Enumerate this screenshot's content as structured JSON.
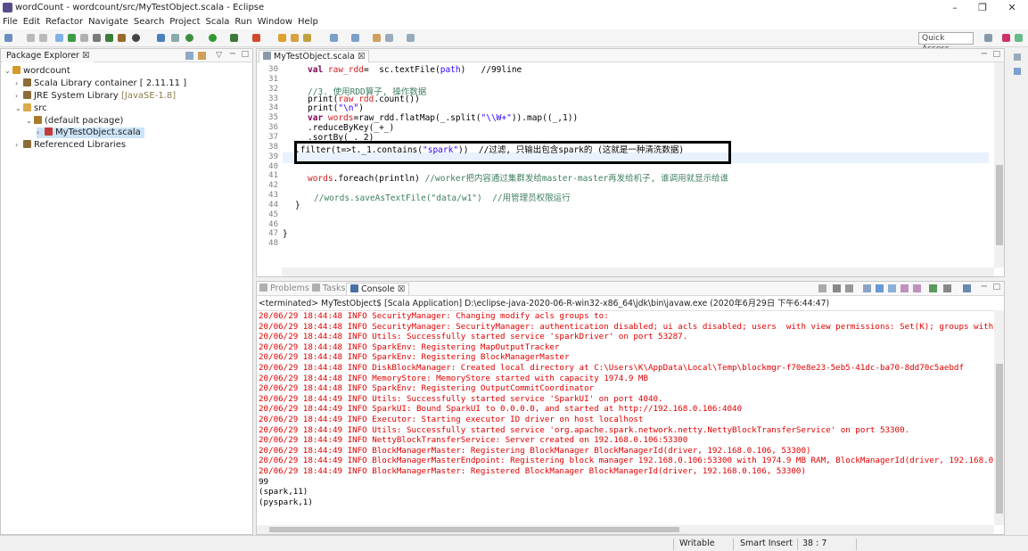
{
  "window": {
    "title": "wordCount - wordcount/src/MyTestObject.scala - Eclipse",
    "minimize": "–",
    "maximize": "❐",
    "close": "✕"
  },
  "menu": [
    "File",
    "Edit",
    "Refactor",
    "Navigate",
    "Search",
    "Project",
    "Scala",
    "Run",
    "Window",
    "Help"
  ],
  "toolbar": {
    "quick_access": "Quick Access"
  },
  "package_explorer": {
    "tab": "Package Explorer ☒",
    "items": [
      {
        "label": "wordcount",
        "extra": ""
      },
      {
        "label": "Scala Library container",
        "extra": "[ 2.11.11 ]"
      },
      {
        "label": "JRE System Library",
        "extra": "[JavaSE-1.8]"
      },
      {
        "label": "src",
        "extra": ""
      },
      {
        "label": "(default package)",
        "extra": ""
      },
      {
        "label": "MyTestObject.scala",
        "extra": ""
      },
      {
        "label": "Referenced Libraries",
        "extra": ""
      }
    ]
  },
  "editor": {
    "tab": "MyTestObject.scala ☒",
    "line_numbers": [
      "30",
      "31",
      "32",
      "33",
      "34",
      "35",
      "36",
      "37",
      "38",
      "39",
      "40",
      "41",
      "42",
      "43",
      "44",
      "45",
      "46",
      "47",
      "48"
    ],
    "lines": [
      {
        "a": "val ",
        "b": "raw_rdd",
        "c": "=  sc.textFile(",
        "d": "path",
        "e": ")   //99line"
      },
      {
        "a": "",
        "b": "",
        "c": "",
        "d": "",
        "e": ""
      },
      {
        "a": "",
        "b": "",
        "c": "",
        "d": "",
        "e": "//3. 使用RDD算子, 操作数据"
      },
      {
        "a": "print(",
        "b": "raw_rdd",
        "c": ".count())",
        "d": "",
        "e": ""
      },
      {
        "a": "print(",
        "b": "",
        "c": "",
        "d": "\"\\n\"",
        "e": ")"
      },
      {
        "a": "var ",
        "b": "words",
        "c": "=raw_rdd.flatMap(_.split(",
        "d": "\"\\\\W+\"",
        "e": ")).map((_,1))"
      },
      {
        "a": ".reduceByKey(_+_)",
        "b": "",
        "c": "",
        "d": "",
        "e": ""
      },
      {
        "a": ".sortBy(_._2)",
        "b": "",
        "c": "",
        "d": "",
        "e": ""
      },
      {
        "a": ".filter(t=>t._1.contains(",
        "b": "",
        "c": "",
        "d": "\"spark\"",
        "e": "))  //过滤, 只输出包含spark的 (这就是一种清洗数据)"
      },
      {
        "a": "",
        "b": "",
        "c": "",
        "d": "",
        "e": ""
      },
      {
        "a": "",
        "b": "",
        "c": "",
        "d": "",
        "e": ""
      },
      {
        "a": "",
        "b": "words",
        "c": ".foreach(println) ",
        "d": "",
        "e": "//worker把内容通过集群发给master-master再发给机子, 谁调用就显示给谁"
      },
      {
        "a": "",
        "b": "",
        "c": "",
        "d": "",
        "e": ""
      },
      {
        "a": "",
        "b": "",
        "c": "",
        "d": "",
        "e": "//words.saveAsTextFile(\"data/w1\")  //用管理员权限运行"
      },
      {
        "a": "}",
        "b": "",
        "c": "",
        "d": "",
        "e": ""
      },
      {
        "a": "",
        "b": "",
        "c": "",
        "d": "",
        "e": ""
      },
      {
        "a": "",
        "b": "",
        "c": "",
        "d": "",
        "e": ""
      },
      {
        "a": "}",
        "b": "",
        "c": "",
        "d": "",
        "e": ""
      },
      {
        "a": "",
        "b": "",
        "c": "",
        "d": "",
        "e": ""
      }
    ]
  },
  "console": {
    "tabs": [
      "Problems",
      "Tasks",
      "Console ☒"
    ],
    "terminated": "<terminated> MyTestObject$ [Scala Application] D:\\eclipse-java-2020-06-R-win32-x86_64\\jdk\\bin\\javaw.exe (2020年6月29日 下午6:44:47)",
    "log": [
      "20/06/29 18:44:48 INFO SecurityManager: Changing modify acls groups to:",
      "20/06/29 18:44:48 INFO SecurityManager: SecurityManager: authentication disabled; ui acls disabled; users  with view permissions: Set(K); groups with vie",
      "20/06/29 18:44:48 INFO Utils: Successfully started service 'sparkDriver' on port 53287.",
      "20/06/29 18:44:48 INFO SparkEnv: Registering MapOutputTracker",
      "20/06/29 18:44:48 INFO SparkEnv: Registering BlockManagerMaster",
      "20/06/29 18:44:48 INFO DiskBlockManager: Created local directory at C:\\Users\\K\\AppData\\Local\\Temp\\blockmgr-f70e8e23-5eb5-41dc-ba70-8dd70c5aebdf",
      "20/06/29 18:44:48 INFO MemoryStore: MemoryStore started with capacity 1974.9 MB",
      "20/06/29 18:44:48 INFO SparkEnv: Registering OutputCommitCoordinator",
      "20/06/29 18:44:49 INFO Utils: Successfully started service 'SparkUI' on port 4040.",
      "20/06/29 18:44:49 INFO SparkUI: Bound SparkUI to 0.0.0.0, and started at http://192.168.0.106:4040",
      "20/06/29 18:44:49 INFO Executor: Starting executor ID driver on host localhost",
      "20/06/29 18:44:49 INFO Utils: Successfully started service 'org.apache.spark.network.netty.NettyBlockTransferService' on port 53300.",
      "20/06/29 18:44:49 INFO NettyBlockTransferService: Server created on 192.168.0.106:53300",
      "20/06/29 18:44:49 INFO BlockManagerMaster: Registering BlockManager BlockManagerId(driver, 192.168.0.106, 53300)",
      "20/06/29 18:44:49 INFO BlockManagerMasterEndpoint: Registering block manager 192.168.0.106:53300 with 1974.9 MB RAM, BlockManagerId(driver, 192.168.0.106",
      "20/06/29 18:44:49 INFO BlockManagerMaster: Registered BlockManager BlockManagerId(driver, 192.168.0.106, 53300)"
    ],
    "output": [
      "99",
      "(spark,11)",
      "(pyspark,1)"
    ]
  },
  "status": {
    "writable": "Writable",
    "insert_mode": "Smart Insert",
    "position": "38 : 7"
  }
}
